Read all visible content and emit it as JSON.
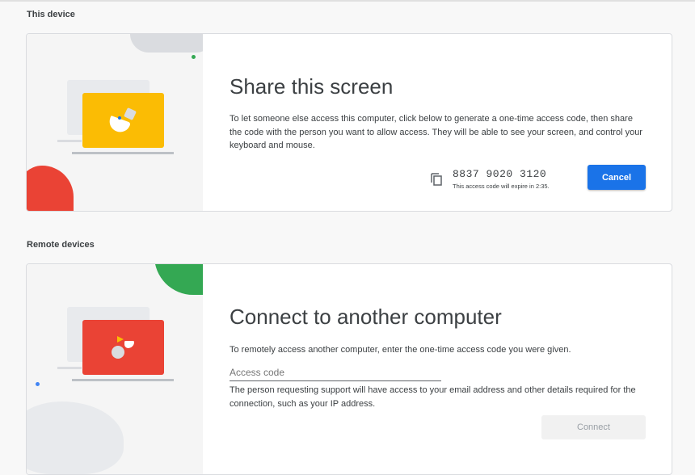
{
  "share": {
    "section": "This device",
    "title": "Share this screen",
    "description": "To let someone else access this computer, click below to generate a one-time access code, then share the code with the person you want to allow access. They will be able to see your screen, and control your keyboard and mouse.",
    "code": "8837 9020 3120",
    "expiry": "This access code will expire in 2:35.",
    "cancel_label": "Cancel",
    "copy_icon": "copy-icon"
  },
  "connect": {
    "section": "Remote devices",
    "title": "Connect to another computer",
    "description": "To remotely access another computer, enter the one-time access code you were given.",
    "placeholder": "Access code",
    "note": "The person requesting support will have access to your email address and other details required for the connection, such as your IP address.",
    "connect_label": "Connect"
  },
  "colors": {
    "accent": "#1a73e8",
    "yellow": "#fbbc04",
    "red": "#ea4335",
    "green": "#34a853"
  }
}
